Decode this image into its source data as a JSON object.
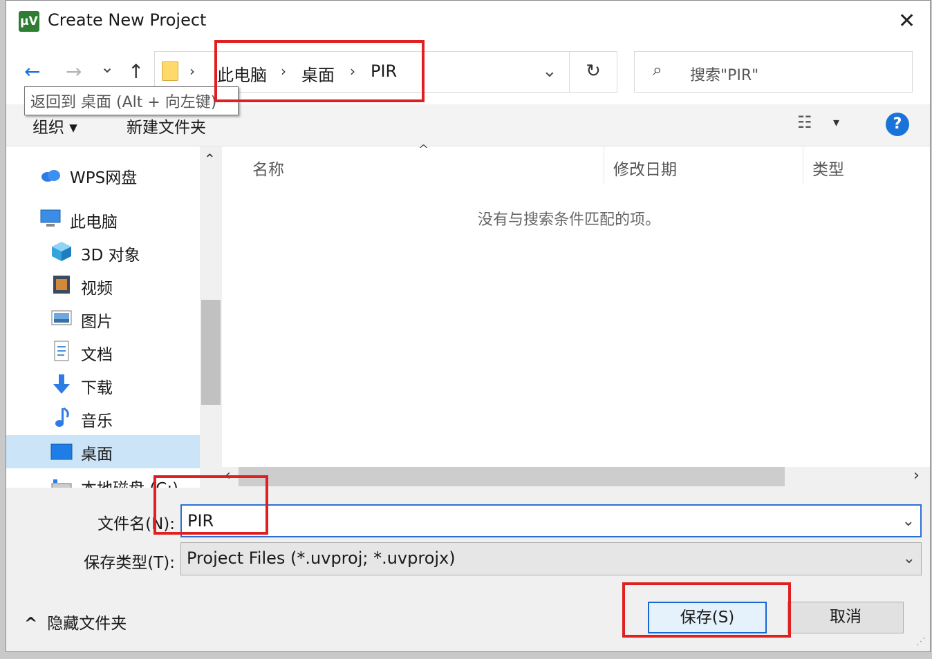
{
  "window": {
    "title": "Create New Project",
    "app_icon_text": "μV"
  },
  "nav": {
    "back_icon": "←",
    "forward_icon": "→",
    "recent_icon": "⌄",
    "up_icon": "↑",
    "breadcrumb": [
      "此电脑",
      "桌面",
      "PIR"
    ],
    "separator": "›",
    "address_dropdown_icon": "⌄",
    "refresh_icon": "↻",
    "search_icon": "⌕",
    "search_placeholder": "搜索\"PIR\"",
    "tooltip": "返回到 桌面 (Alt + 向左键)"
  },
  "commands": {
    "organize": "组织 ▾",
    "new_folder": "新建文件夹",
    "view_icon": "☷",
    "view_dropdown": "▾",
    "help": "?"
  },
  "sidebar": {
    "items": [
      {
        "label": "WPS网盘",
        "icon": "cloud-icon"
      },
      {
        "label": "此电脑",
        "icon": "computer-icon"
      },
      {
        "label": "3D 对象",
        "icon": "cube-icon"
      },
      {
        "label": "视频",
        "icon": "video-icon"
      },
      {
        "label": "图片",
        "icon": "pictures-icon"
      },
      {
        "label": "文档",
        "icon": "document-icon"
      },
      {
        "label": "下载",
        "icon": "download-icon"
      },
      {
        "label": "音乐",
        "icon": "music-icon"
      },
      {
        "label": "桌面",
        "icon": "desktop-icon",
        "selected": true
      },
      {
        "label": "本地磁盘 (C:)",
        "icon": "disk-icon"
      }
    ],
    "scroll_up_icon": "⌃"
  },
  "files": {
    "columns": [
      "名称",
      "修改日期",
      "类型"
    ],
    "sort_indicator": "^",
    "empty_message": "没有与搜索条件匹配的项。",
    "scroll_left_icon": "‹",
    "scroll_right_icon": "›"
  },
  "form": {
    "filename_label": "文件名(N):",
    "filename_value": "PIR",
    "filetype_label": "保存类型(T):",
    "filetype_value": "Project Files (*.uvproj; *.uvprojx)",
    "dropdown_icon": "⌄"
  },
  "footer": {
    "hide_folders": "隐藏文件夹",
    "hide_icon": "^",
    "save_button": "保存(S)",
    "cancel_button": "取消"
  },
  "colors": {
    "highlight_box": "#e02020",
    "accent": "#1666d4",
    "selected_bg": "#cce4f7"
  }
}
